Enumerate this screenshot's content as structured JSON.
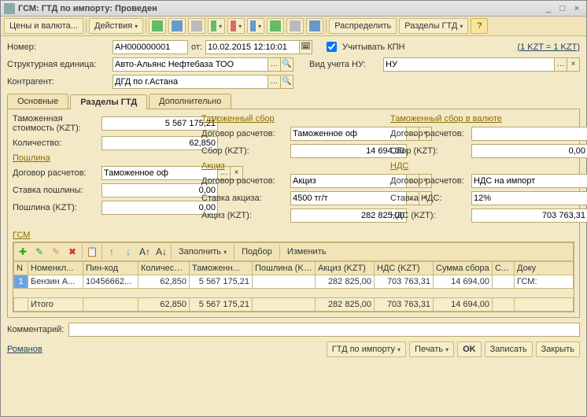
{
  "window": {
    "title": "ГСМ: ГТД по импорту: Проведен",
    "min": "_",
    "max": "□",
    "close": "×"
  },
  "toolbar": {
    "prices": "Цены и валюта...",
    "actions": "Действия",
    "distribute": "Распределить",
    "gtdsec": "Разделы ГТД"
  },
  "hdr": {
    "num_lbl": "Номер:",
    "num": "АН000000001",
    "ot": "от:",
    "date": "10.02.2015 12:10:01",
    "kpn": "Учитывать КПН",
    "kpn_checked": true,
    "rate": "(1 KZT = 1 KZT)",
    "struct_lbl": "Структурная единица:",
    "struct": "Авто-Альянс Нефтебаза ТОО",
    "vid_lbl": "Вид учета НУ:",
    "vid": "НУ",
    "contr_lbl": "Контрагент:",
    "contr": "ДГД по г.Астана"
  },
  "tabs": {
    "t1": "Основные",
    "t2": "Разделы ГТД",
    "t3": "Дополнительно"
  },
  "col1": {
    "cost_lbl": "Таможенная стоимость (KZT):",
    "cost": "5 567 175,21",
    "qty_lbl": "Количество:",
    "qty": "62,850",
    "sect": "Пошлина",
    "dog_lbl": "Договор расчетов:",
    "dog": "Таможенное оф",
    "rate_lbl": "Ставка пошлины:",
    "rate": "0,00",
    "duty_lbl": "Пошлина (KZT):",
    "duty": "0,00"
  },
  "col2": {
    "sect1": "Таможенный сбор",
    "dog_lbl": "Договор расчетов:",
    "dog": "Таможенное оф",
    "sbor_lbl": "Сбор (KZT):",
    "sbor": "14 694,00",
    "sect2": "Акциз",
    "dog2_lbl": "Договор расчетов:",
    "dog2": "Акциз",
    "rate_lbl": "Ставка акциза:",
    "rate": "4500 тг/т",
    "akc_lbl": "Акциз (KZT):",
    "akc": "282 825,00"
  },
  "col3": {
    "sect1": "Таможенный сбор в валюте",
    "dog_lbl": "Договор расчетов:",
    "dog": "",
    "sbor_lbl": "Сбор (KZT):",
    "sbor": "0,00",
    "sect2": "НДС",
    "dog2_lbl": "Договор расчетов:",
    "dog2": "НДС на импорт",
    "rate_lbl": "Ставка НДС:",
    "rate": "12%",
    "nds_lbl": "НДС (KZT):",
    "nds": "703 763,31"
  },
  "gsm": {
    "title": "ГСМ",
    "fill": "Заполнить",
    "pick": "Подбор",
    "edit": "Изменить",
    "cols": [
      "N",
      "Номенкл...",
      "Пин-код",
      "Количество",
      "Таможенн...",
      "Пошлина (KZT)",
      "Акциз (KZT)",
      "НДС (KZT)",
      "Сумма сбора",
      "С...",
      "Доку"
    ],
    "row": {
      "n": "1",
      "nom": "Бензин А...",
      "pin": "10456662...",
      "qty": "62,850",
      "cost": "5 567 175,21",
      "duty": "",
      "akc": "282 825,00",
      "nds": "703 763,31",
      "sbor": "14 694,00",
      "s": "",
      "doc": "ГСМ:"
    },
    "tot_lbl": "Итого",
    "tot": {
      "qty": "62,850",
      "cost": "5 567 175,21",
      "duty": "",
      "akc": "282 825,00",
      "nds": "703 763,31",
      "sbor": "14 694,00"
    }
  },
  "comment_lbl": "Комментарий:",
  "comment": "",
  "status": {
    "user": "Романов",
    "gtd": "ГТД по импорту",
    "print": "Печать",
    "ok": "OK",
    "write": "Записать",
    "close": "Закрыть"
  }
}
